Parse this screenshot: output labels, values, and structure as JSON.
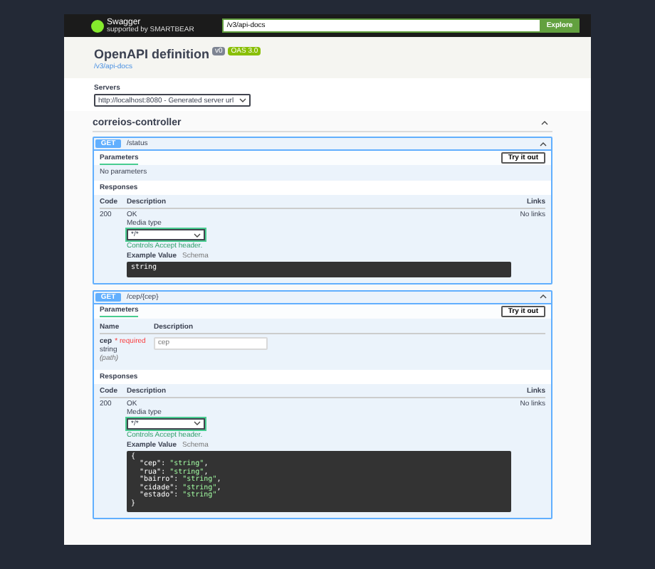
{
  "topbar": {
    "logo": "Swagger",
    "logo_subtitle": "supported by SMARTBEAR",
    "url": "/v3/api-docs",
    "explore": "Explore"
  },
  "info": {
    "title": "OpenAPI definition",
    "version": "v0",
    "oas": "OAS 3.0",
    "link": "/v3/api-docs"
  },
  "servers": {
    "label": "Servers",
    "value": "http://localhost:8080 - Generated server url"
  },
  "tag": {
    "name": "correios-controller",
    "expanded": true
  },
  "operations": [
    {
      "method": "GET",
      "path": "/status",
      "expanded": true,
      "params_title": "Parameters",
      "try_button": "Try it out",
      "no_params": "No parameters",
      "responses_title": "Responses",
      "columns": [
        "Code",
        "Description",
        "Links"
      ],
      "responses": [
        {
          "code": "200",
          "description": "OK",
          "media_label": "Media type",
          "media": "*/*",
          "media_hint": "Controls Accept header.",
          "example_tab": "Example Value",
          "schema_tab": "Schema",
          "example": "string",
          "links": "No links"
        }
      ]
    },
    {
      "method": "GET",
      "path": "/cep/{cep}",
      "expanded": true,
      "params_title": "Parameters",
      "try_button": "Try it out",
      "param_columns": [
        "Name",
        "Description"
      ],
      "parameters": [
        {
          "name": "cep",
          "required": "* required",
          "type": "string",
          "location": "(path)",
          "placeholder": "cep"
        }
      ],
      "responses_title": "Responses",
      "columns": [
        "Code",
        "Description",
        "Links"
      ],
      "responses": [
        {
          "code": "200",
          "description": "OK",
          "media_label": "Media type",
          "media": "*/*",
          "media_hint": "Controls Accept header.",
          "example_tab": "Example Value",
          "schema_tab": "Schema",
          "example": "{\n  \"cep\": \"string\",\n  \"rua\": \"string\",\n  \"bairro\": \"string\",\n  \"cidade\": \"string\",\n  \"estado\": \"string\"\n}",
          "links": "No links"
        }
      ]
    }
  ]
}
